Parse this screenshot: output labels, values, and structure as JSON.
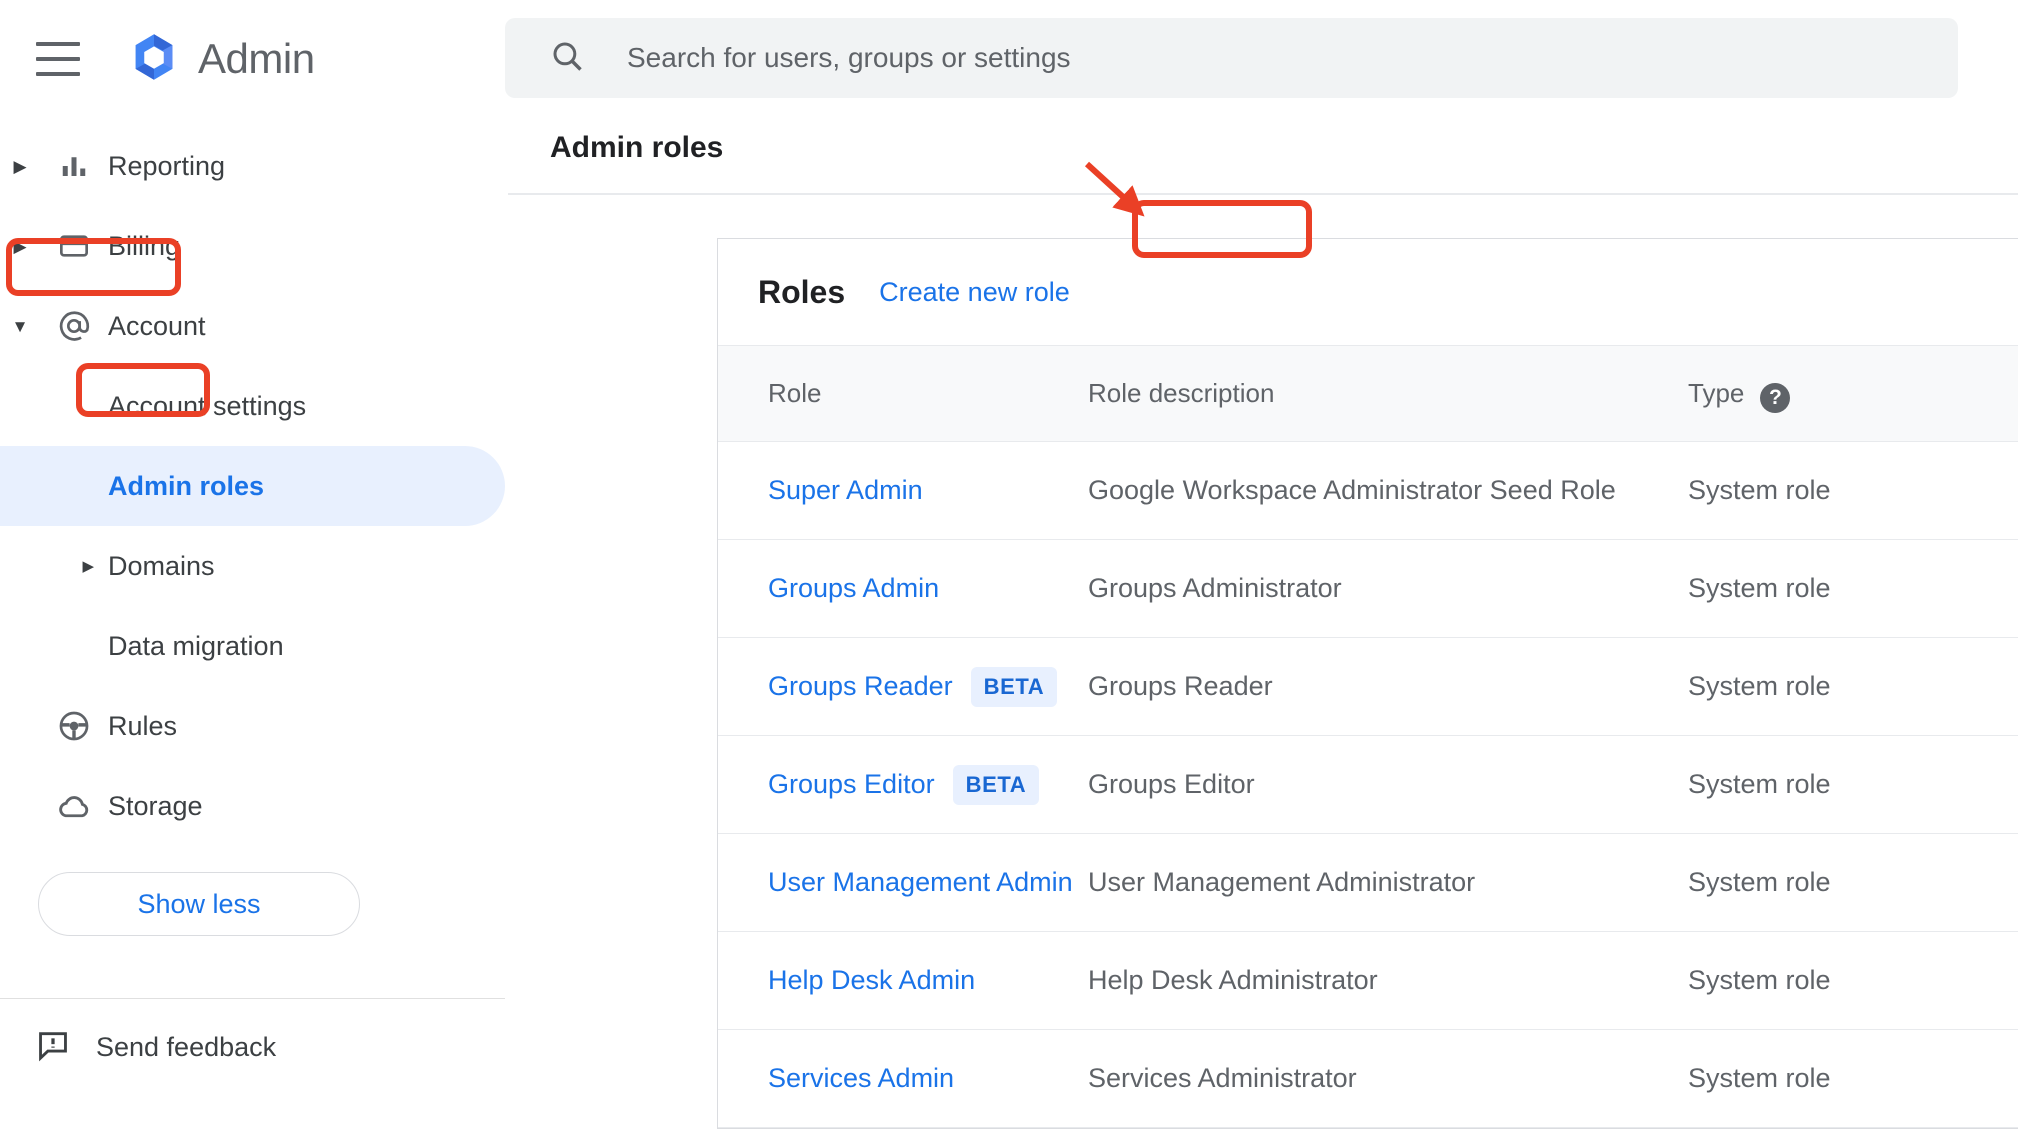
{
  "brand": {
    "title": "Admin",
    "logo_icon": "google-admin-logo-icon",
    "menu_icon": "hamburger-menu-icon"
  },
  "search": {
    "placeholder": "Search for users, groups or settings",
    "icon": "search-icon",
    "value": ""
  },
  "page": {
    "title": "Admin roles"
  },
  "sidebar": {
    "items": [
      {
        "label": "Reporting",
        "icon": "bar-chart-icon",
        "caret": "▶",
        "type": "top"
      },
      {
        "label": "Billing",
        "icon": "credit-card-icon",
        "caret": "▶",
        "type": "top"
      },
      {
        "label": "Account",
        "icon": "at-sign-icon",
        "caret": "▼",
        "type": "top",
        "highlighted": true
      },
      {
        "label": "Account settings",
        "icon": "",
        "caret": "",
        "type": "sub"
      },
      {
        "label": "Admin roles",
        "icon": "",
        "caret": "",
        "type": "sub",
        "selected": true,
        "highlighted": true
      },
      {
        "label": "Domains",
        "icon": "",
        "caret": "▶",
        "type": "sub"
      },
      {
        "label": "Data migration",
        "icon": "",
        "caret": "",
        "type": "sub"
      },
      {
        "label": "Rules",
        "icon": "steering-wheel-icon",
        "caret": "",
        "type": "top"
      },
      {
        "label": "Storage",
        "icon": "cloud-icon",
        "caret": "",
        "type": "top"
      }
    ],
    "show_less_label": "Show less",
    "send_feedback": {
      "label": "Send feedback",
      "icon": "feedback-icon"
    }
  },
  "roles_card": {
    "title": "Roles",
    "create_label": "Create new role",
    "columns": [
      "Role",
      "Role description",
      "Type"
    ],
    "type_help_icon": "help-icon",
    "rows": [
      {
        "role": "Super Admin",
        "badge": "",
        "description": "Google Workspace Administrator Seed Role",
        "type": "System role"
      },
      {
        "role": "Groups Admin",
        "badge": "",
        "description": "Groups Administrator",
        "type": "System role"
      },
      {
        "role": "Groups Reader",
        "badge": "BETA",
        "description": "Groups Reader",
        "type": "System role"
      },
      {
        "role": "Groups Editor",
        "badge": "BETA",
        "description": "Groups Editor",
        "type": "System role"
      },
      {
        "role": "User Management Admin",
        "badge": "",
        "description": "User Management Administrator",
        "type": "System role"
      },
      {
        "role": "Help Desk Admin",
        "badge": "",
        "description": "Help Desk Administrator",
        "type": "System role"
      },
      {
        "role": "Services Admin",
        "badge": "",
        "description": "Services Administrator",
        "type": "System role"
      }
    ]
  },
  "annotations": {
    "color": "#ea4026",
    "highlighted": [
      "Account",
      "Admin roles",
      "Create new role"
    ],
    "arrow": "arrow-pointing-to-create-new-role"
  },
  "colors": {
    "accent_blue": "#1a73e8",
    "selected_bg": "#e8f0fe",
    "annotation_red": "#ea4026",
    "text_primary": "#202124",
    "text_secondary": "#5f6368"
  }
}
